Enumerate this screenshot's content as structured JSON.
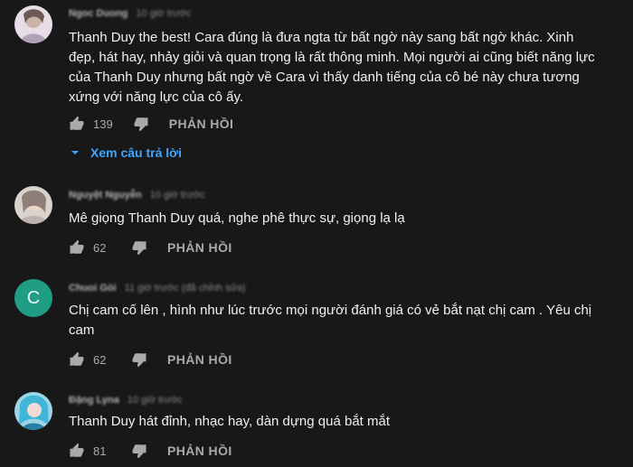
{
  "comments": [
    {
      "author": "Ngoc Duong",
      "time": "10 giờ trước",
      "text": "Thanh Duy the best! Cara đúng là đưa ngta từ bất ngờ này sang bất ngờ khác. Xinh đẹp, hát hay, nhảy giỏi và quan trọng là rất thông minh. Mọi người ai cũng biết năng lực của Thanh Duy nhưng bất ngờ về Cara vì thấy danh tiếng của cô bé này chưa tương xứng với năng lực của cô ấy.",
      "likes": "139",
      "reply_label": "PHẢN HỒI",
      "avatar_letter": "",
      "avatar_color": "#d8c8d8"
    },
    {
      "author": "Nguyệt Nguyễn",
      "time": "10 giờ trước",
      "text": "Mê giọng Thanh Duy quá, nghe phê thực sự, giọng lạ lạ",
      "likes": "62",
      "reply_label": "PHẢN HỒI",
      "avatar_letter": "",
      "avatar_color": "#cfc7c2"
    },
    {
      "author": "Chuoi Gòi",
      "time": "11 giờ trước (đã chỉnh sửa)",
      "text": "Chị cam cố lên , hình như lúc trước mọi người đánh giá có vẻ bắt nạt chị cam . Yêu chị cam",
      "likes": "62",
      "reply_label": "PHẢN HỒI",
      "avatar_letter": "C",
      "avatar_color": "#1f9e85"
    },
    {
      "author": "Đặng Lyna",
      "time": "10 giờ trước",
      "text": "Thanh Duy hát đỉnh, nhạc hay, dàn dựng quá bắt mắt",
      "likes": "81",
      "reply_label": "PHẢN HỒI",
      "avatar_letter": "",
      "avatar_color": "#5fb6d6"
    }
  ],
  "view_replies_label": "Xem câu trả lời",
  "colors": {
    "background": "#181818",
    "text": "#f1f1f1",
    "muted": "#aaaaaa",
    "link": "#3ea6ff"
  }
}
